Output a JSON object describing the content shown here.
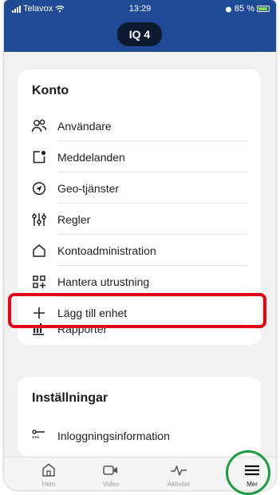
{
  "status": {
    "carrier": "Telavox",
    "time": "13:29",
    "battery": "85 %"
  },
  "header": {
    "title": "IQ 4"
  },
  "konto": {
    "title": "Konto",
    "items": [
      {
        "label": "Användare",
        "icon": "users-icon"
      },
      {
        "label": "Meddelanden",
        "icon": "message-icon"
      },
      {
        "label": "Geo-tjänster",
        "icon": "location-arrow-icon"
      },
      {
        "label": "Regler",
        "icon": "sliders-icon"
      },
      {
        "label": "Kontoadministration",
        "icon": "home-outline-icon"
      },
      {
        "label": "Hantera utrustning",
        "icon": "devices-grid-icon"
      },
      {
        "label": "Lägg till enhet",
        "icon": "plus-icon"
      },
      {
        "label": "Rapporter",
        "icon": "bar-chart-icon"
      }
    ]
  },
  "installningar": {
    "title": "Inställningar",
    "items": [
      {
        "label": "Inloggningsinformation",
        "icon": "key-password-icon"
      }
    ]
  },
  "tabs": [
    {
      "label": "Hem",
      "icon": "home-icon"
    },
    {
      "label": "Video",
      "icon": "video-camera-icon"
    },
    {
      "label": "Aktivitet",
      "icon": "activity-pulse-icon"
    },
    {
      "label": "Mer",
      "icon": "hamburger-menu-icon"
    }
  ],
  "colors": {
    "header": "#1f4a96",
    "highlight_red": "#e60014",
    "highlight_green": "#1a9a3a"
  }
}
